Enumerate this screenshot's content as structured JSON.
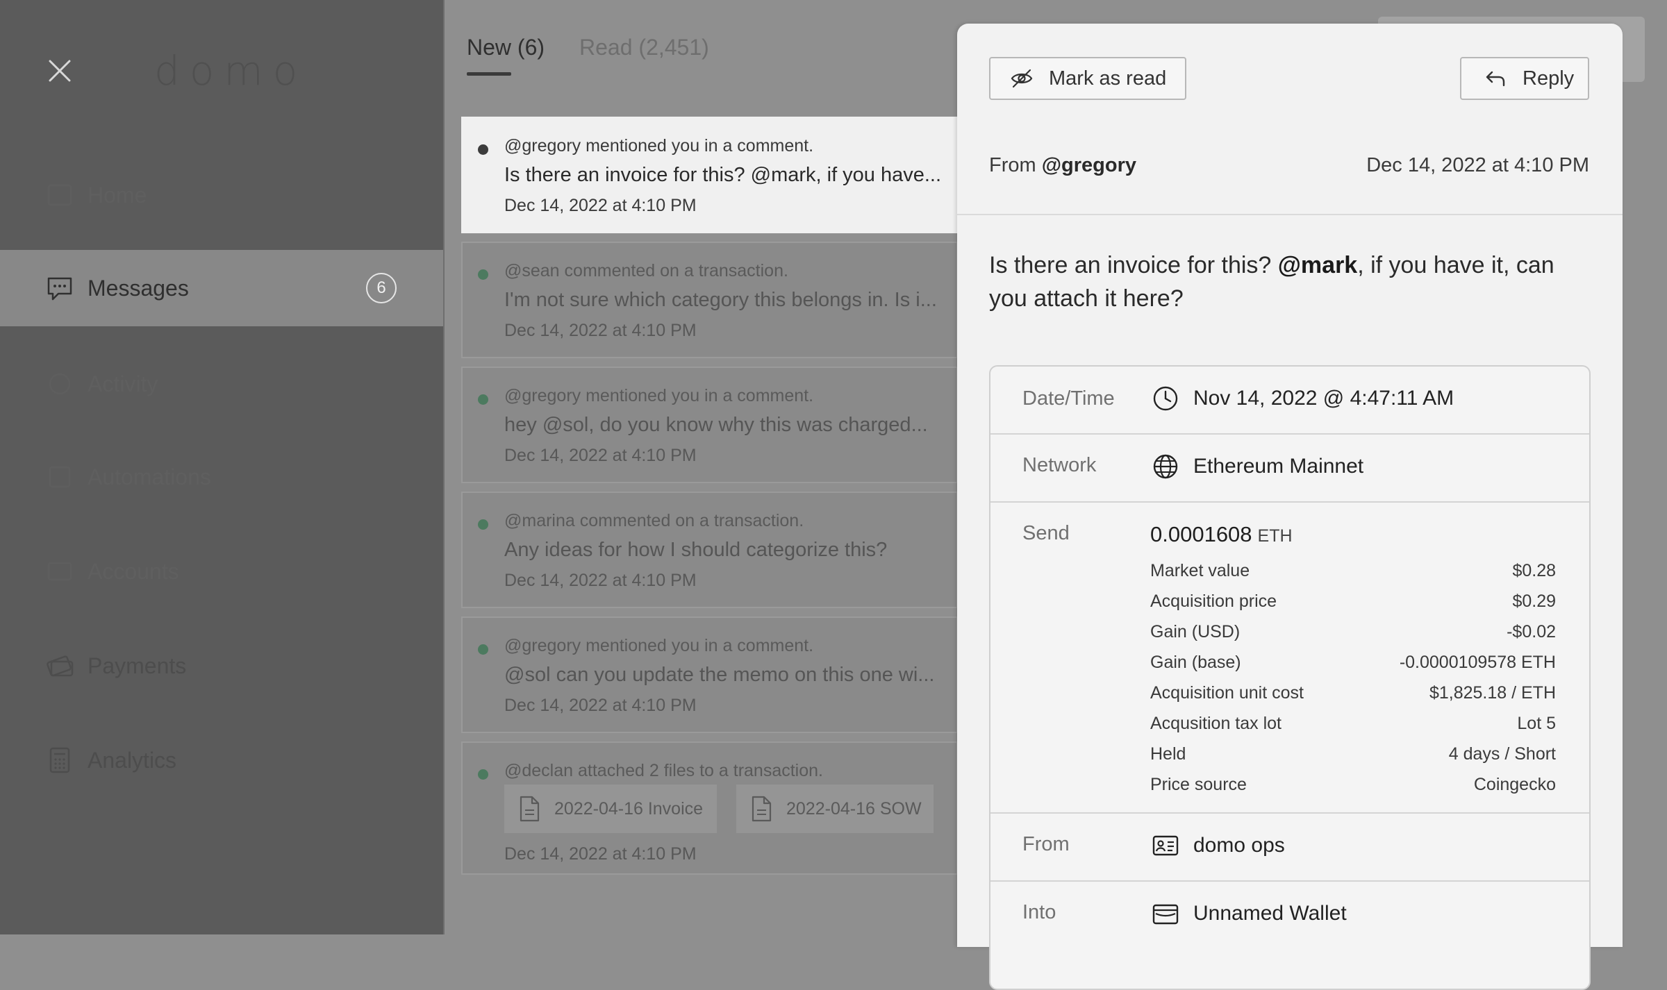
{
  "app": {
    "logo": "domo"
  },
  "sidebar": {
    "items": [
      {
        "label": "Home"
      },
      {
        "label": "Messages",
        "badge": "6"
      },
      {
        "label": "Activity"
      },
      {
        "label": "Automations"
      },
      {
        "label": "Accounts"
      },
      {
        "label": "Payments"
      },
      {
        "label": "Analytics"
      }
    ]
  },
  "tabs": {
    "new_label": "New (6)",
    "read_label": "Read (2,451)"
  },
  "messages": [
    {
      "subject": "@gregory mentioned you in a comment.",
      "body": "Is there an invoice for this? @mark, if you have...",
      "time": "Dec 14, 2022 at 4:10 PM"
    },
    {
      "subject": "@sean commented on a transaction.",
      "body": "I'm not sure which category this belongs in. Is i...",
      "time": "Dec 14, 2022 at 4:10 PM"
    },
    {
      "subject": "@gregory mentioned you in a comment.",
      "body": "hey @sol, do you know why this was charged...",
      "time": "Dec 14, 2022 at 4:10 PM"
    },
    {
      "subject": "@marina commented on a transaction.",
      "body": "Any ideas for how I should categorize this?",
      "time": "Dec 14, 2022 at 4:10 PM"
    },
    {
      "subject": "@gregory mentioned you in a comment.",
      "body": "@sol can you update the memo on this one wi...",
      "time": "Dec 14, 2022 at 4:10 PM"
    },
    {
      "subject": "@declan attached 2 files to a transaction.",
      "files": [
        "2022-04-16 Invoice",
        "2022-04-16 SOW"
      ],
      "time": "Dec 14, 2022 at 4:10 PM"
    }
  ],
  "detail": {
    "mark_read_label": "Mark as read",
    "reply_label": "Reply",
    "from_prefix": "From",
    "from_user": "@gregory",
    "date": "Dec 14, 2022 at 4:10 PM",
    "text_before": "Is there an invoice for this? ",
    "mention": "@mark",
    "text_after": ", if you have it, can you attach it here?",
    "transaction": {
      "datetime_label": "Date/Time",
      "datetime_value": "Nov 14, 2022 @ 4:47:11 AM",
      "network_label": "Network",
      "network_value": "Ethereum Mainnet",
      "send_label": "Send",
      "send_amount": "0.0001608",
      "send_unit": "ETH",
      "details": [
        {
          "k": "Market value",
          "v": "$0.28"
        },
        {
          "k": "Acquisition price",
          "v": "$0.29"
        },
        {
          "k": "Gain (USD)",
          "v": "-$0.02"
        },
        {
          "k": "Gain (base)",
          "v": "-0.0000109578 ETH"
        },
        {
          "k": "Acquisition unit cost",
          "v": "$1,825.18 / ETH"
        },
        {
          "k": "Acqusition tax lot",
          "v": "Lot 5"
        },
        {
          "k": "Held",
          "v": "4 days / Short"
        },
        {
          "k": "Price source",
          "v": "Coingecko"
        }
      ],
      "from_label": "From",
      "from_value": "domo ops",
      "into_label": "Into",
      "into_value": "Unnamed Wallet"
    }
  }
}
